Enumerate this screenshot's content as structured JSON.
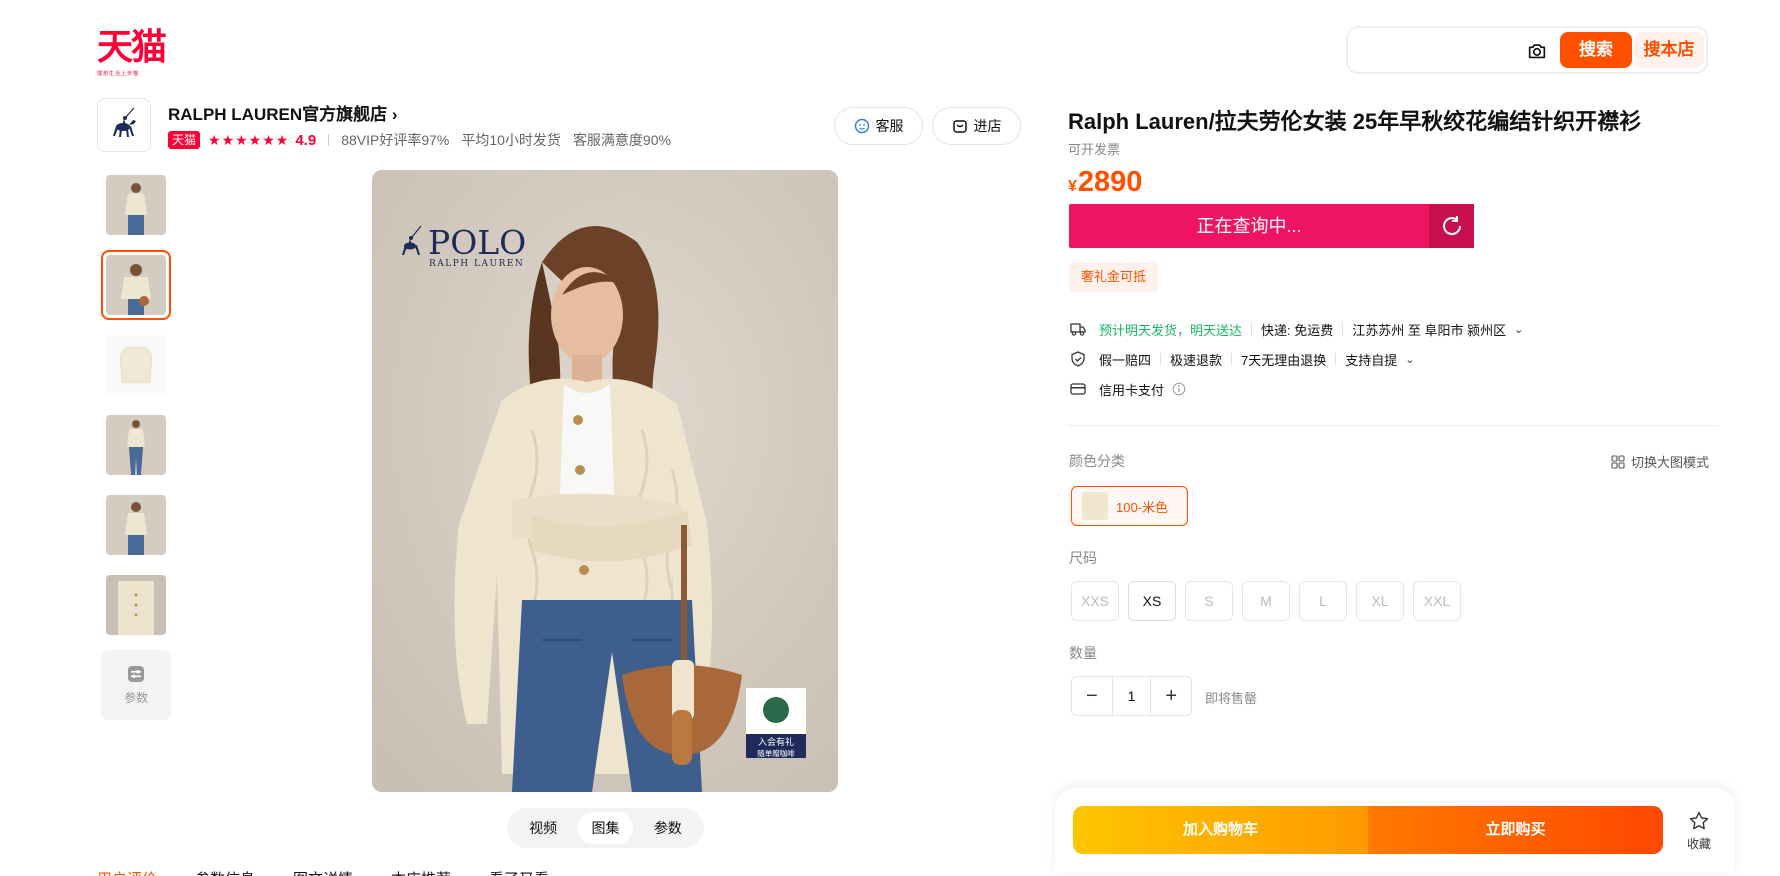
{
  "header": {
    "logo_text": "天猫",
    "logo_slogan": "理想生活上天猫",
    "search": {
      "placeholder": "",
      "search_label": "搜索",
      "search_shop_label": "搜本店"
    }
  },
  "shop": {
    "name": "RALPH LAUREN官方旗舰店",
    "badge": "天猫",
    "stars": "★★★★★★",
    "score": "4.9",
    "metrics": [
      "88VIP好评率97%",
      "平均10小时发货",
      "客服满意度90%"
    ],
    "kefu_label": "客服",
    "enter_label": "进店"
  },
  "gallery": {
    "thumb_count": 6,
    "active_index": 1,
    "params_label": "参数",
    "main_logo": "POLO",
    "main_logo_sub": "RALPH LAUREN",
    "sticker_line1": "入会有礼",
    "sticker_line2": "随单赠咖啡",
    "media_tabs": [
      "视频",
      "图集",
      "参数"
    ],
    "active_media_tab": 1
  },
  "bottom_tabs": [
    "用户评价",
    "参数信息",
    "图文详情",
    "本店推荐",
    "看了又看"
  ],
  "product": {
    "title": "Ralph Lauren/拉夫劳伦女装 25年早秋绞花编结针织开襟衫",
    "invoice": "可开发票",
    "currency": "¥",
    "price": "2890",
    "querying": "正在查询中...",
    "promo_tag": "奢礼金可抵",
    "delivery": {
      "promise": "预计明天发货，明天送达",
      "shipping": "快递: 免运费",
      "route": "江苏苏州 至 阜阳市 颍州区"
    },
    "guarantees": [
      "假一赔四",
      "极速退款",
      "7天无理由退换",
      "支持自提"
    ],
    "payment": "信用卡支付"
  },
  "sku": {
    "color_label": "颜色分类",
    "switch_mode": "切换大图模式",
    "color_selected": "100-米色",
    "size_label": "尺码",
    "sizes": [
      {
        "label": "XXS",
        "available": false
      },
      {
        "label": "XS",
        "available": true
      },
      {
        "label": "S",
        "available": false
      },
      {
        "label": "M",
        "available": false
      },
      {
        "label": "L",
        "available": false
      },
      {
        "label": "XL",
        "available": false
      },
      {
        "label": "XXL",
        "available": false
      }
    ],
    "qty_label": "数量",
    "qty_value": "1",
    "presale_note": "即将售罄"
  },
  "actions": {
    "add_to_cart": "加入购物车",
    "buy_now": "立即购买",
    "favorite": "收藏"
  },
  "colors": {
    "tmall_red": "#ff0036",
    "accent_orange": "#ff5000",
    "query_pink": "#ef1461",
    "delivery_green": "#18b566"
  }
}
